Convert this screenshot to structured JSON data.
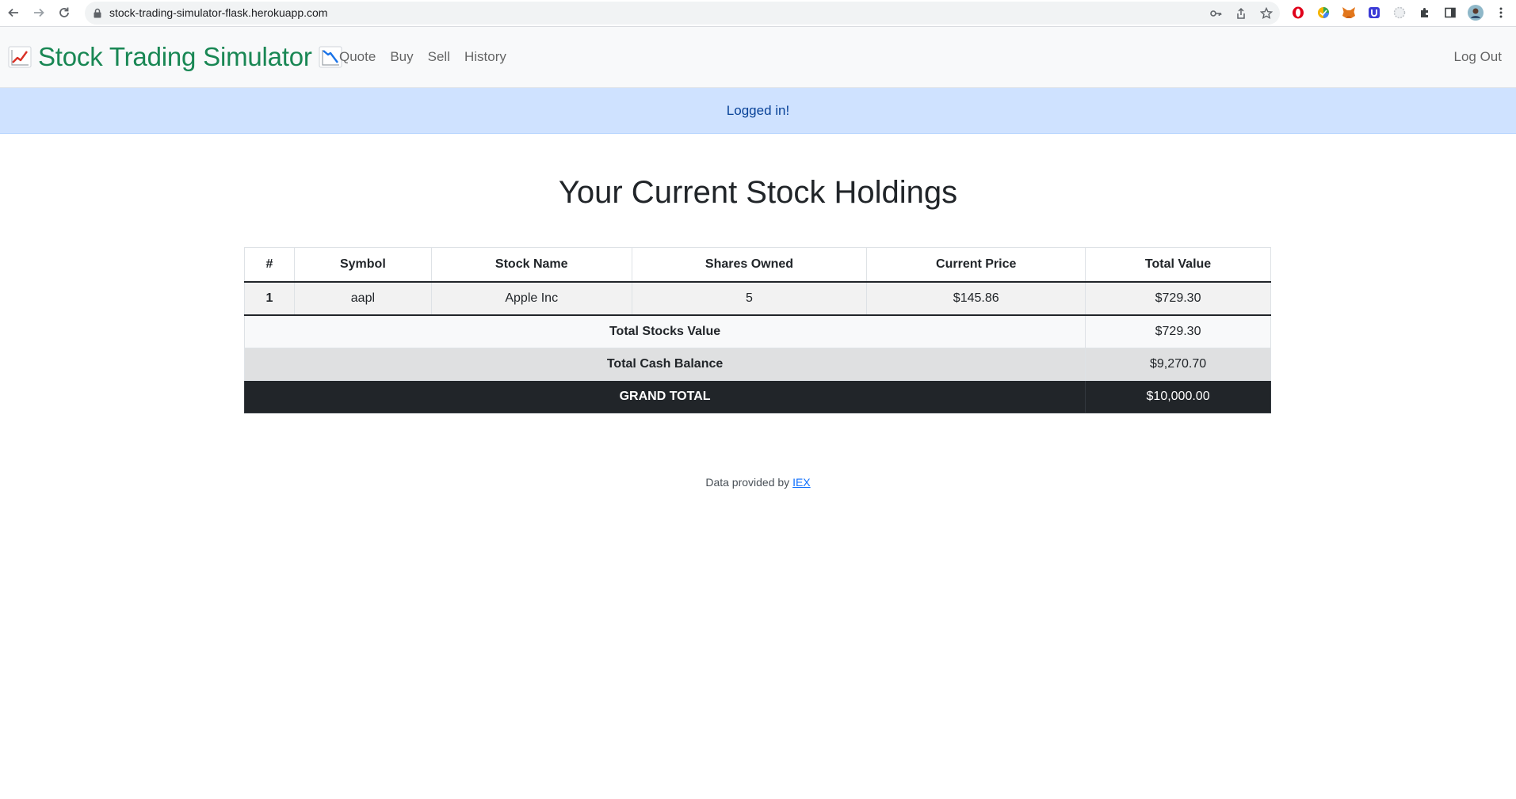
{
  "browser": {
    "url": "stock-trading-simulator-flask.herokuapp.com"
  },
  "navbar": {
    "brand": "Stock Trading Simulator",
    "links": [
      "Quote",
      "Buy",
      "Sell",
      "History"
    ],
    "logout": "Log Out"
  },
  "alert": {
    "message": "Logged in!"
  },
  "main": {
    "title": "Your Current Stock Holdings",
    "table": {
      "headers": [
        "#",
        "Symbol",
        "Stock Name",
        "Shares Owned",
        "Current Price",
        "Total Value"
      ],
      "rows": [
        {
          "index": "1",
          "symbol": "aapl",
          "name": "Apple Inc",
          "shares": "5",
          "price": "$145.86",
          "total": "$729.30"
        }
      ],
      "summary": {
        "stocks_label": "Total Stocks Value",
        "stocks_value": "$729.30",
        "cash_label": "Total Cash Balance",
        "cash_value": "$9,270.70",
        "grand_label": "GRAND TOTAL",
        "grand_value": "$10,000.00"
      }
    }
  },
  "footer": {
    "text": "Data provided by ",
    "link": "IEX"
  },
  "colors": {
    "brand": "#198754",
    "alert_bg": "#cfe2ff",
    "alert_text": "#084298",
    "grand_bg": "#212529",
    "link": "#0d6efd"
  },
  "icons": {
    "brand_left": "chart-increasing-icon",
    "brand_right": "chart-decreasing-icon"
  }
}
